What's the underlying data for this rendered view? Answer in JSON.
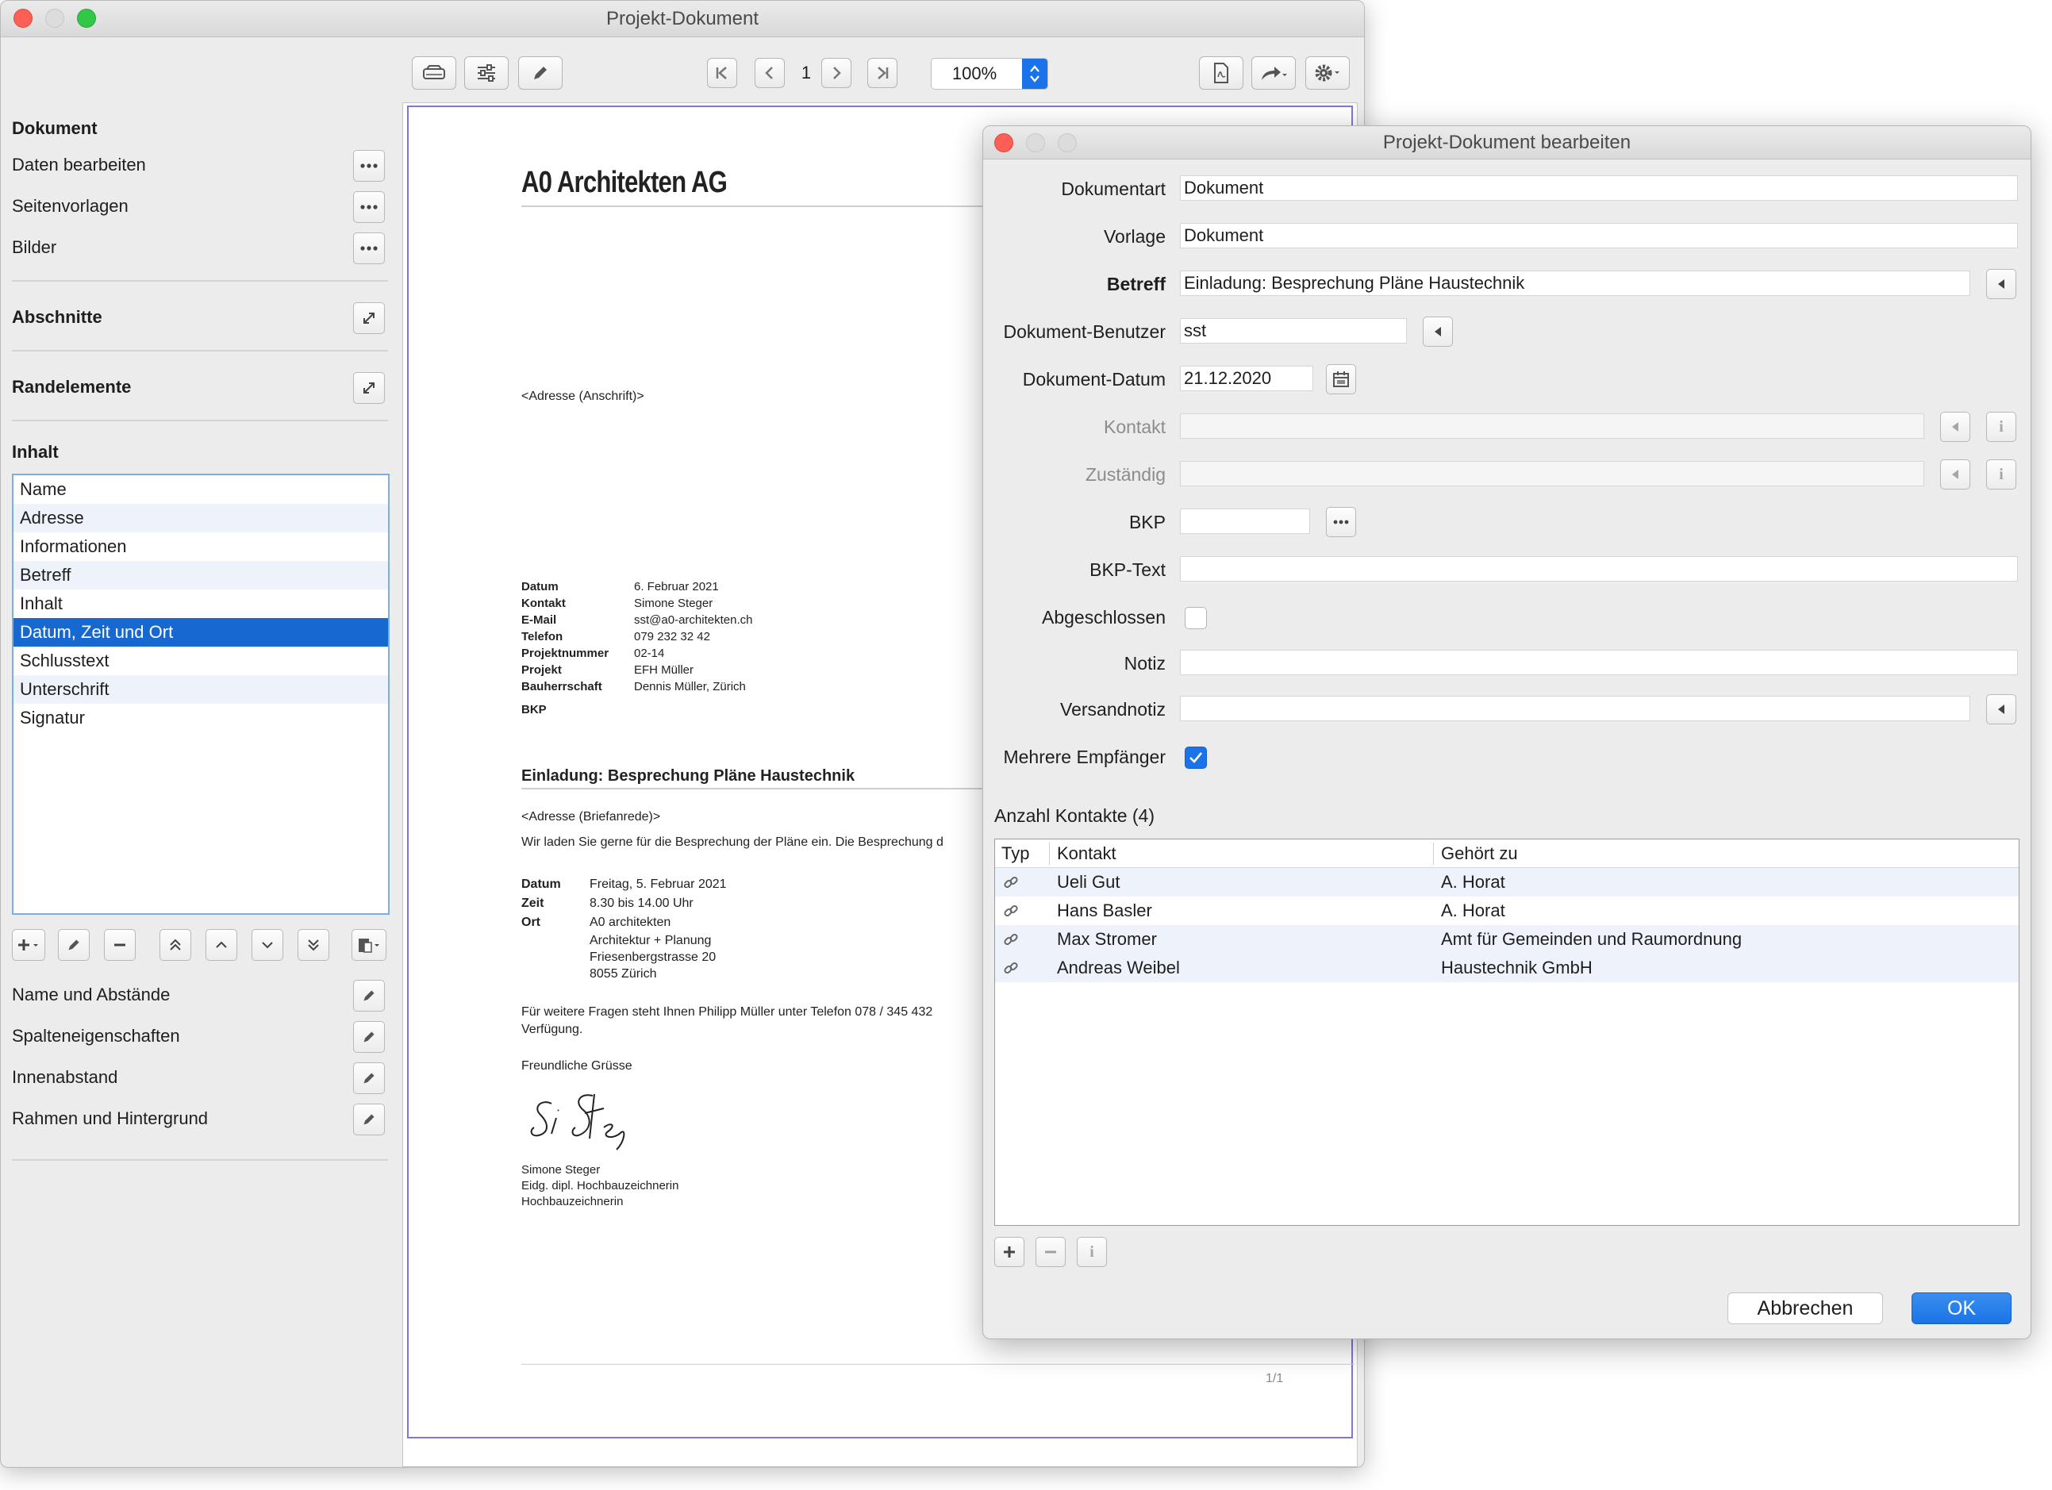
{
  "main_window": {
    "title": "Projekt-Dokument",
    "page_number": "1",
    "zoom": "100%"
  },
  "sidebar": {
    "dokument_heading": "Dokument",
    "dokument_items": [
      "Daten bearbeiten",
      "Seitenvorlagen",
      "Bilder"
    ],
    "abschnitte_heading": "Abschnitte",
    "randelemente_heading": "Randelemente",
    "inhalt_heading": "Inhalt",
    "content_items": [
      "Name",
      "Adresse",
      "Informationen",
      "Betreff",
      "Inhalt",
      "Datum, Zeit und Ort",
      "Schlusstext",
      "Unterschrift",
      "Signatur"
    ],
    "selected_index": 5,
    "property_items": [
      "Name und Abstände",
      "Spalteneigenschaften",
      "Innenabstand",
      "Rahmen und Hintergrund"
    ]
  },
  "document": {
    "company": "A0 Architekten AG",
    "address_placeholder": "<Adresse (Anschrift)>",
    "info_rows": [
      {
        "label": "Datum",
        "value": "6. Februar 2021"
      },
      {
        "label": "Kontakt",
        "value": "Simone Steger"
      },
      {
        "label": "E-Mail",
        "value": "sst@a0-architekten.ch"
      },
      {
        "label": "Telefon",
        "value": "079 232 32 42"
      },
      {
        "label": "Projektnummer",
        "value": "02-14"
      },
      {
        "label": "Projekt",
        "value": "EFH Müller"
      },
      {
        "label": "Bauherrschaft",
        "value": "Dennis Müller, Zürich"
      },
      {
        "label": "BKP",
        "value": ""
      }
    ],
    "subject": "Einladung: Besprechung Pläne Haustechnik",
    "salutation": "<Adresse (Briefanrede)>",
    "intro": "Wir laden Sie gerne für die Besprechung der Pläne ein. Die Besprechung d",
    "event_rows": [
      {
        "label": "Datum",
        "value": "Freitag, 5. Februar 2021"
      },
      {
        "label": "Zeit",
        "value": "8.30 bis 14.00 Uhr"
      },
      {
        "label": "Ort",
        "value": "A0 architekten"
      }
    ],
    "address_lines": [
      "Architektur + Planung",
      "Friesenbergstrasse 20",
      "8055 Zürich"
    ],
    "closing_line1": "Für weitere Fragen steht Ihnen Philipp Müller unter Telefon 078 / 345 432",
    "closing_line2": "Verfügung.",
    "greeting": "Freundliche Grüsse",
    "signature_name": "Simone Steger",
    "signature_role1": "Eidg. dipl. Hochbauzeichnerin",
    "signature_role2": "Hochbauzeichnerin",
    "page_counter": "1/1"
  },
  "dialog": {
    "title": "Projekt-Dokument bearbeiten",
    "labels": {
      "dokumentart": "Dokumentart",
      "vorlage": "Vorlage",
      "betreff": "Betreff",
      "benutzer": "Dokument-Benutzer",
      "datum": "Dokument-Datum",
      "kontakt": "Kontakt",
      "zustaendig": "Zuständig",
      "bkp": "BKP",
      "bkp_text": "BKP-Text",
      "abgeschlossen": "Abgeschlossen",
      "notiz": "Notiz",
      "versandnotiz": "Versandnotiz",
      "mehrere": "Mehrere Empfänger"
    },
    "values": {
      "dokumentart": "Dokument",
      "vorlage": "Dokument",
      "betreff": "Einladung: Besprechung Pläne Haustechnik",
      "benutzer": "sst",
      "datum": "21.12.2020",
      "kontakt": "",
      "zustaendig": "",
      "bkp": "",
      "bkp_text": "",
      "notiz": "",
      "versandnotiz": ""
    },
    "abgeschlossen_checked": false,
    "mehrere_checked": true,
    "count_label": "Anzahl Kontakte (4)",
    "table_headers": [
      "Typ",
      "Kontakt",
      "Gehört zu"
    ],
    "contacts": [
      {
        "name": "Ueli Gut",
        "belongs": "A. Horat"
      },
      {
        "name": "Hans Basler",
        "belongs": "A. Horat"
      },
      {
        "name": "Max Stromer",
        "belongs": "Amt für Gemeinden und Raumordnung"
      },
      {
        "name": "Andreas Weibel",
        "belongs": "Haustechnik GmbH"
      }
    ],
    "cancel_label": "Abbrechen",
    "ok_label": "OK",
    "accent": "#1a73e8"
  }
}
